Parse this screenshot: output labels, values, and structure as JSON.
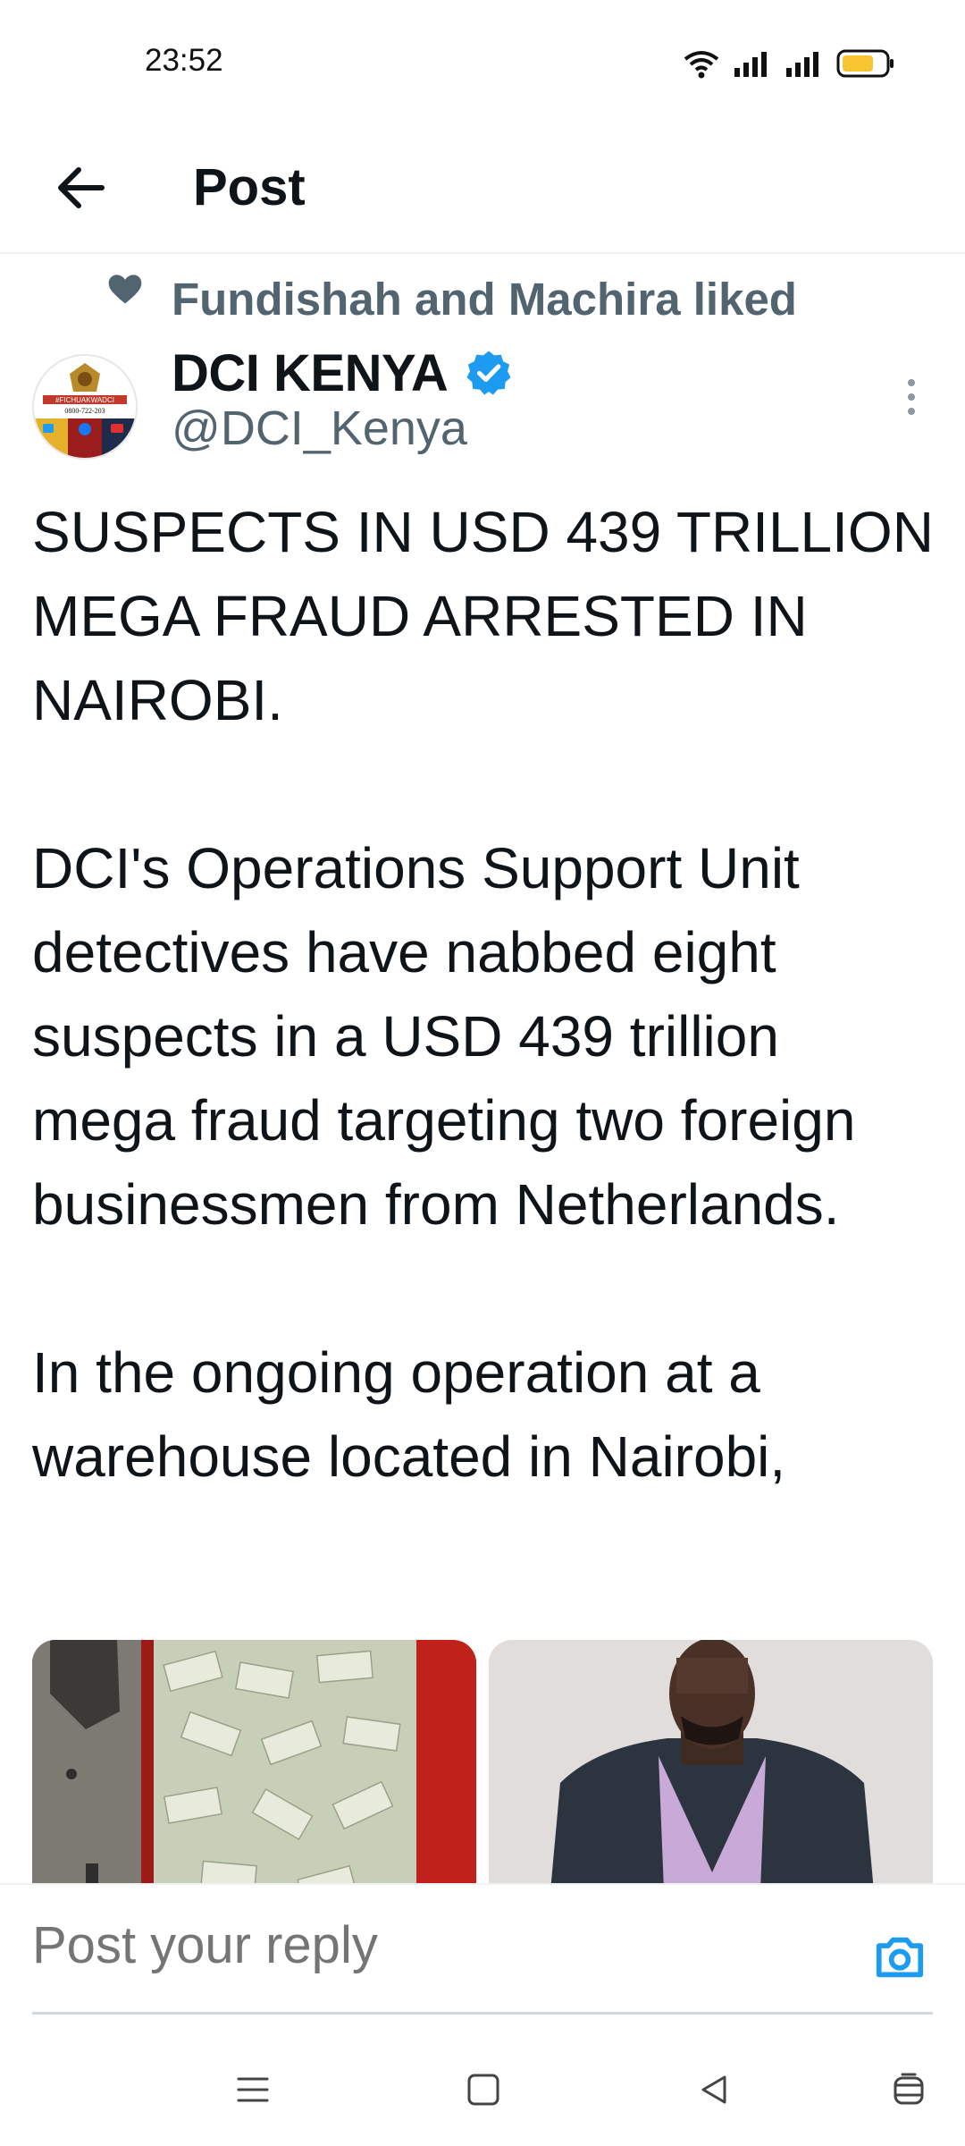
{
  "status_bar": {
    "time": "23:52"
  },
  "header": {
    "title": "Post"
  },
  "social_context": {
    "text": "Fundishah and Machira liked"
  },
  "author": {
    "name": "DCI KENYA",
    "handle": "@DCI_Kenya",
    "avatar_text": "#FICHUAKWADCI",
    "avatar_phone": "0800-722-203"
  },
  "post": {
    "paragraphs": [
      "SUSPECTS IN USD 439 TRILLION MEGA FRAUD ARRESTED IN NAIROBI.",
      "DCI's Operations Support Unit detectives have nabbed eight suspects in a USD 439 trillion mega fraud targeting two foreign businessmen from Netherlands.",
      "In the ongoing operation at a warehouse located in Nairobi,"
    ]
  },
  "reply": {
    "placeholder": "Post your reply"
  },
  "colors": {
    "accent": "#1d9bf0",
    "secondary_text": "#536471",
    "battery": "#f7c52f"
  }
}
